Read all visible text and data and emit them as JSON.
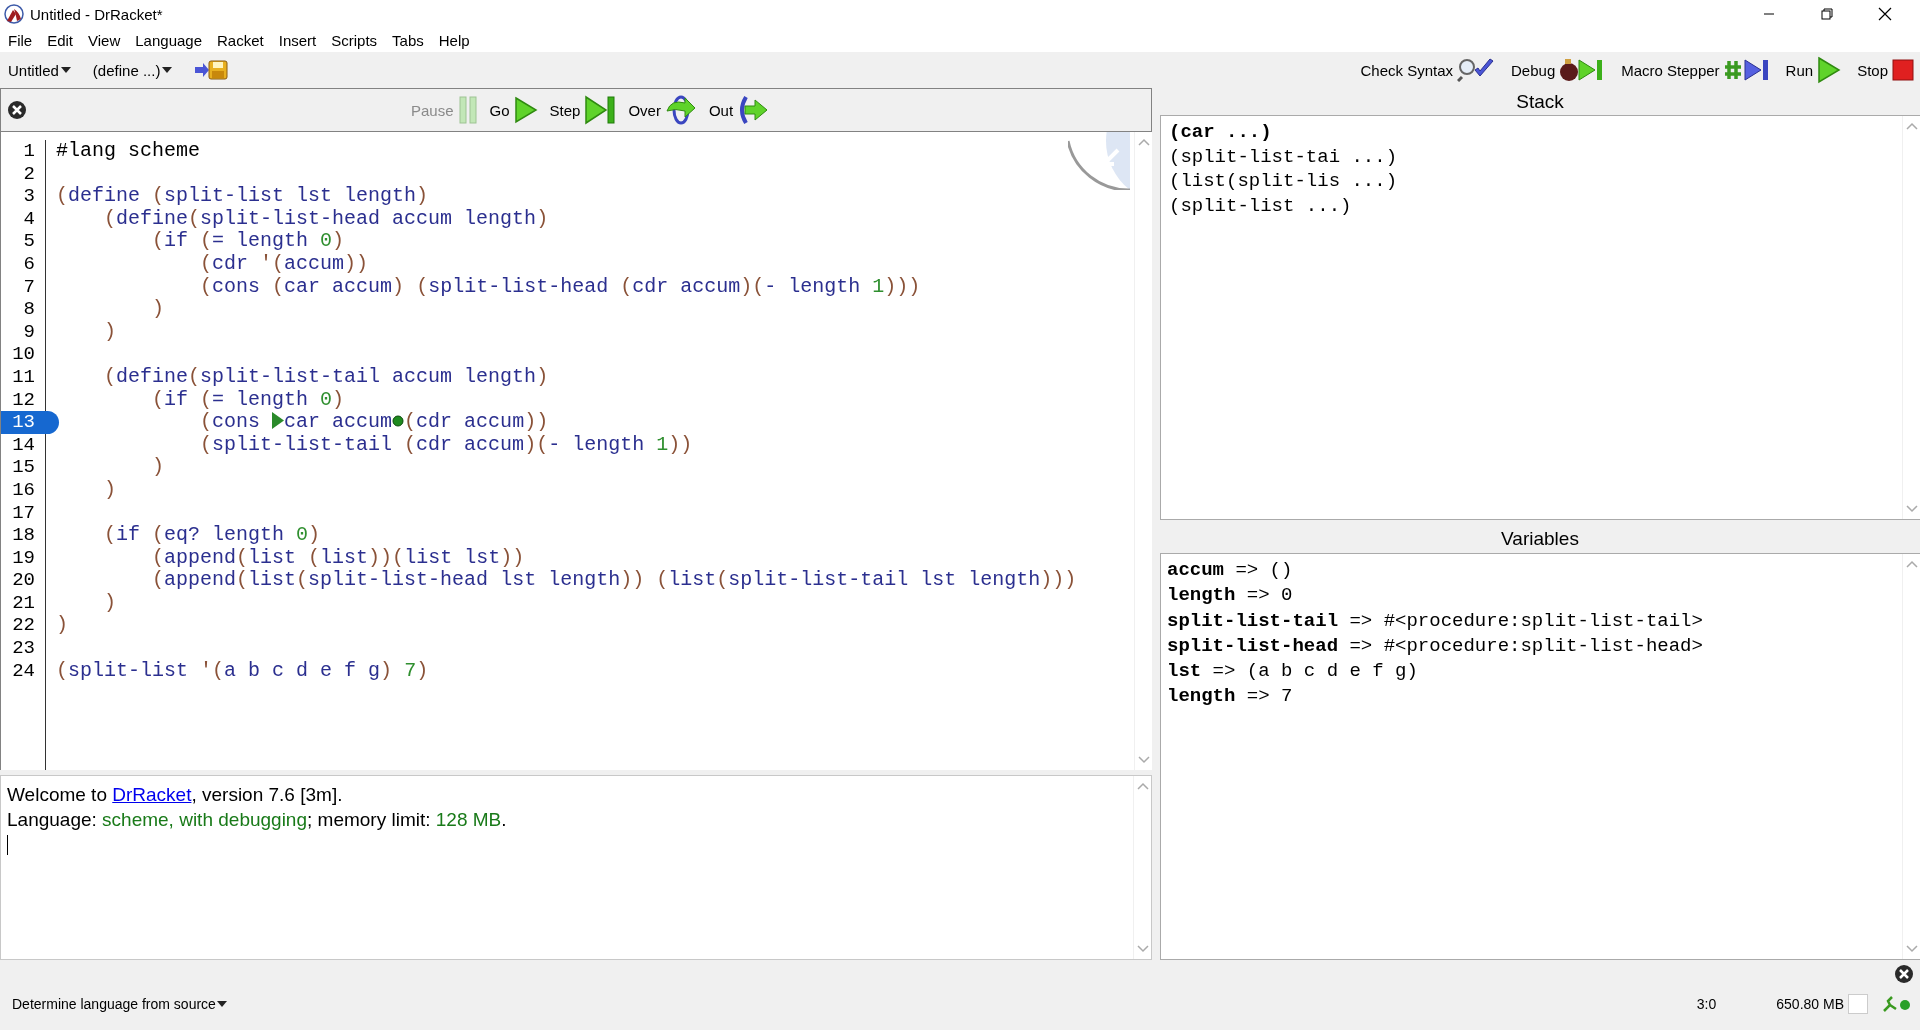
{
  "window": {
    "title": "Untitled - DrRacket*"
  },
  "menu": [
    "File",
    "Edit",
    "View",
    "Language",
    "Racket",
    "Insert",
    "Scripts",
    "Tabs",
    "Help"
  ],
  "toolbar": {
    "file_menu": "Untitled",
    "define_menu": "(define ...)",
    "buttons": [
      {
        "label": "Check Syntax"
      },
      {
        "label": "Debug"
      },
      {
        "label": "Macro Stepper"
      },
      {
        "label": "Run"
      },
      {
        "label": "Stop"
      }
    ]
  },
  "debug_bar": {
    "buttons": [
      {
        "label": "Pause",
        "disabled": true
      },
      {
        "label": "Go",
        "disabled": false
      },
      {
        "label": "Step",
        "disabled": false
      },
      {
        "label": "Over",
        "disabled": false
      },
      {
        "label": "Out",
        "disabled": false
      }
    ]
  },
  "editor": {
    "lines": [
      {
        "number": "1",
        "current": false,
        "kind": "lang",
        "parts": [
          {
            "text": "#lang scheme"
          }
        ]
      },
      {
        "number": "2",
        "current": false,
        "kind": "code"
      },
      {
        "number": "3",
        "current": false,
        "kind": "code",
        "parts": [
          {
            "text": "(define (split-list lst length)"
          }
        ]
      },
      {
        "number": "4",
        "current": false,
        "kind": "code",
        "parts": [
          {
            "text": "    (define(split-list-head accum length)"
          }
        ]
      },
      {
        "number": "5",
        "current": false,
        "kind": "code",
        "parts": [
          {
            "text": "        (if (= length 0)"
          }
        ]
      },
      {
        "number": "6",
        "current": false,
        "kind": "code",
        "parts": [
          {
            "text": "            (cdr '(accum))"
          }
        ]
      },
      {
        "number": "7",
        "current": false,
        "kind": "code",
        "parts": [
          {
            "text": "            (cons (car accum) (split-list-head (cdr accum)(- length 1)))"
          }
        ]
      },
      {
        "number": "8",
        "current": false,
        "kind": "code",
        "parts": [
          {
            "text": "        )"
          }
        ]
      },
      {
        "number": "9",
        "current": false,
        "kind": "code",
        "parts": [
          {
            "text": "    )"
          }
        ]
      },
      {
        "number": "10",
        "current": false,
        "kind": "code"
      },
      {
        "number": "11",
        "current": false,
        "kind": "code",
        "parts": [
          {
            "text": "    (define(split-list-tail accum length)"
          }
        ]
      },
      {
        "number": "12",
        "current": false,
        "kind": "code",
        "parts": [
          {
            "text": "        (if (= length 0)"
          }
        ]
      },
      {
        "number": "13",
        "current": true,
        "kind": "code",
        "parts": [
          {
            "kind": "text",
            "text": "            (cons "
          },
          {
            "kind": "breakpoint-start"
          },
          {
            "kind": "text",
            "text": "car accum"
          },
          {
            "kind": "breakpoint-end"
          },
          {
            "kind": "text",
            "text": "(cdr accum))"
          }
        ]
      },
      {
        "number": "14",
        "current": false,
        "kind": "code",
        "parts": [
          {
            "text": "            (split-list-tail (cdr accum)(- length 1))"
          }
        ]
      },
      {
        "number": "15",
        "current": false,
        "kind": "code",
        "parts": [
          {
            "text": "        )"
          }
        ]
      },
      {
        "number": "16",
        "current": false,
        "kind": "code",
        "parts": [
          {
            "text": "    )"
          }
        ]
      },
      {
        "number": "17",
        "current": false,
        "kind": "code"
      },
      {
        "number": "18",
        "current": false,
        "kind": "code",
        "parts": [
          {
            "text": "    (if (eq? length 0)"
          }
        ]
      },
      {
        "number": "19",
        "current": false,
        "kind": "code",
        "parts": [
          {
            "text": "        (append(list (list))(list lst))"
          }
        ]
      },
      {
        "number": "20",
        "current": false,
        "kind": "code",
        "parts": [
          {
            "text": "        (append(list(split-list-head lst length)) (list(split-list-tail lst length)))"
          }
        ]
      },
      {
        "number": "21",
        "current": false,
        "kind": "code",
        "parts": [
          {
            "text": "    )"
          }
        ]
      },
      {
        "number": "22",
        "current": false,
        "kind": "code",
        "parts": [
          {
            "text": ")"
          }
        ]
      },
      {
        "number": "23",
        "current": false,
        "kind": "code"
      },
      {
        "number": "24",
        "current": false,
        "kind": "code",
        "parts": [
          {
            "text": "(split-list '(a b c d e f g) 7)"
          }
        ]
      }
    ]
  },
  "interactions": {
    "lines": [
      [
        {
          "text": "Welcome to ",
          "kind": "plain"
        },
        {
          "text": "DrRacket",
          "kind": "link"
        },
        {
          "text": ", version 7.6 [3m].",
          "kind": "plain"
        }
      ],
      [
        {
          "text": "Language: ",
          "kind": "plain"
        },
        {
          "text": "scheme, with debugging",
          "kind": "value"
        },
        {
          "text": "; memory limit: ",
          "kind": "plain"
        },
        {
          "text": "128 MB",
          "kind": "value"
        },
        {
          "text": ".",
          "kind": "plain"
        }
      ]
    ]
  },
  "stack": {
    "title": "Stack",
    "frames": [
      {
        "text": "(car ...)",
        "current": true
      },
      {
        "text": "(split-list-tai ...)",
        "current": false
      },
      {
        "text": "(list(split-lis ...)",
        "current": false
      },
      {
        "text": "(split-list ...)",
        "current": false
      }
    ]
  },
  "variables": {
    "title": "Variables",
    "items": [
      "**accum** => ()",
      "**length** => 0",
      "**split-list-tail** => #<procedure:split-list-tail>",
      "**split-list-head** => #<procedure:split-list-head>",
      "**lst** => (a b c d e f g)",
      "**length** => 7"
    ]
  },
  "status_bar": {
    "language": "Determine language from source",
    "position": "3:0",
    "memory": "650.80 MB"
  }
}
